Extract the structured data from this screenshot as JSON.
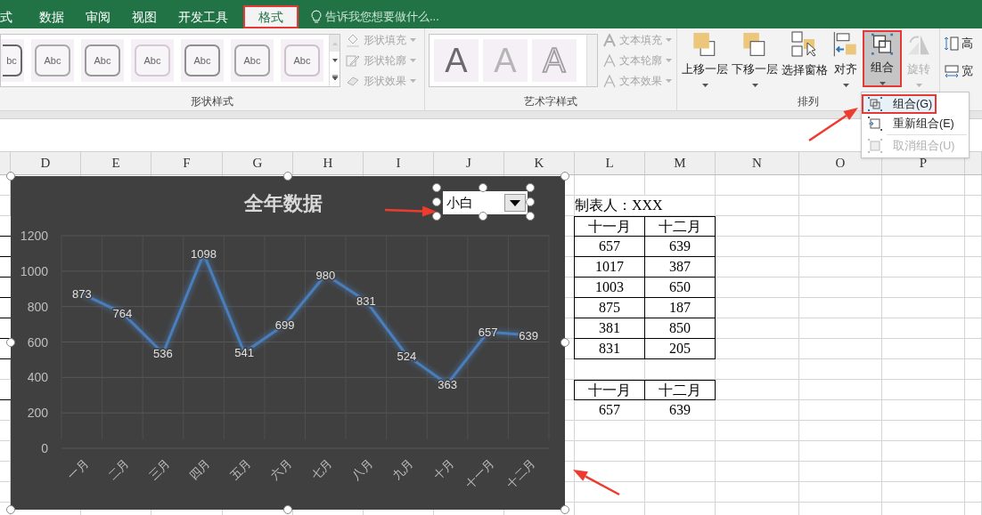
{
  "ribbon_tabs": [
    {
      "label": "式",
      "selected": false
    },
    {
      "label": "数据",
      "selected": false
    },
    {
      "label": "审阅",
      "selected": false
    },
    {
      "label": "视图",
      "selected": false
    },
    {
      "label": "开发工具",
      "selected": false
    },
    {
      "label": "格式",
      "selected": true
    }
  ],
  "tell_me": {
    "placeholder": "告诉我您想要做什么..."
  },
  "shape_styles": {
    "thumbnails": [
      "bc",
      "Abc",
      "Abc",
      "Abc",
      "Abc",
      "Abc",
      "Abc"
    ],
    "commands": [
      {
        "label": "形状填充",
        "disabled": true
      },
      {
        "label": "形状轮廓",
        "disabled": true
      },
      {
        "label": "形状效果",
        "disabled": true
      }
    ],
    "label": "形状样式"
  },
  "wordart_styles": {
    "samples": [
      "A",
      "A",
      "A"
    ],
    "commands": [
      {
        "label": "文本填充",
        "disabled": true
      },
      {
        "label": "文本轮廓",
        "disabled": true
      },
      {
        "label": "文本效果",
        "disabled": true
      }
    ],
    "label": "艺术字样式"
  },
  "arrange": {
    "buttons": [
      {
        "label": "上移一层",
        "dropdown": true,
        "selected": false,
        "disabled": false
      },
      {
        "label": "下移一层",
        "dropdown": true,
        "selected": false,
        "disabled": false
      },
      {
        "label": "选择窗格",
        "dropdown": false,
        "selected": false,
        "disabled": false
      },
      {
        "label": "对齐",
        "dropdown": true,
        "selected": false,
        "disabled": false
      },
      {
        "label": "组合",
        "dropdown": true,
        "selected": true,
        "disabled": false
      },
      {
        "label": "旋转",
        "dropdown": true,
        "selected": false,
        "disabled": true
      }
    ],
    "label": "排列"
  },
  "size": {
    "items": [
      "高",
      "宽"
    ]
  },
  "group_menu": {
    "items": [
      {
        "label": "组合(G)",
        "selected": true,
        "disabled": false
      },
      {
        "label": "重新组合(E)",
        "selected": false,
        "disabled": false
      },
      {
        "label": "取消组合(U)",
        "selected": false,
        "disabled": true
      }
    ]
  },
  "sheet": {
    "columns": [
      "D",
      "E",
      "F",
      "G",
      "H",
      "I",
      "J",
      "K",
      "L",
      "M",
      "N",
      "O",
      "P"
    ],
    "author": "制表人：XXX",
    "table": {
      "headers": [
        "十一月",
        "十二月"
      ],
      "rows": [
        [
          "657",
          "639"
        ],
        [
          "1017",
          "387"
        ],
        [
          "1003",
          "650"
        ],
        [
          "875",
          "187"
        ],
        [
          "381",
          "850"
        ],
        [
          "831",
          "205"
        ]
      ]
    },
    "table_2": {
      "headers": [
        "十一月",
        "十二月"
      ],
      "rows": [
        [
          "657",
          "639"
        ]
      ]
    }
  },
  "chart": {
    "chart_data": {
      "type": "line",
      "title": "全年数据",
      "grid": true,
      "categories": [
        "一月",
        "二月",
        "三月",
        "四月",
        "五月",
        "六月",
        "七月",
        "八月",
        "九月",
        "十月",
        "十一月",
        "十二月"
      ],
      "series": [
        {
          "name": "小白",
          "color": "#4a7ebb",
          "values": [
            873,
            764,
            536,
            1098,
            541,
            699,
            980,
            831,
            524,
            363,
            657,
            639
          ]
        }
      ],
      "ylim": [
        0,
        1200
      ],
      "yticks": [
        0,
        200,
        400,
        600,
        800,
        1000,
        1200
      ],
      "data_labels": true
    }
  }
}
